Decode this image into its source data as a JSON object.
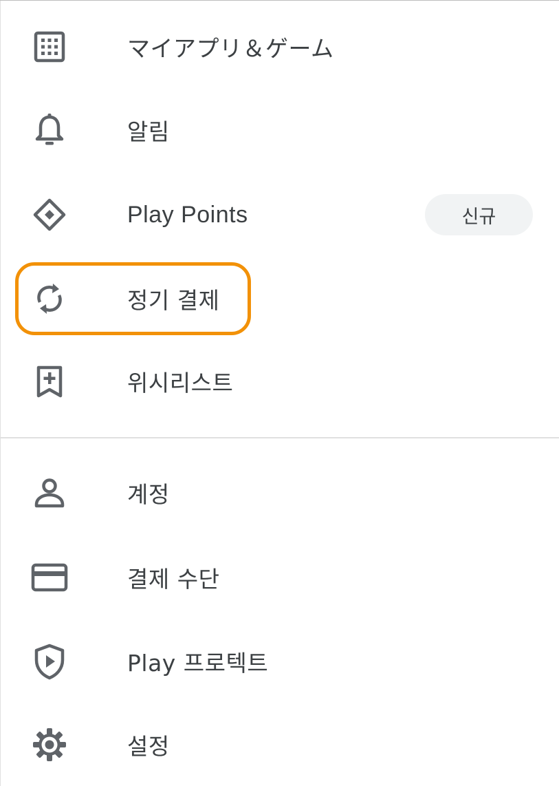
{
  "menu_top": [
    {
      "name": "my-apps-games",
      "icon": "apps-grid-icon",
      "label": "マイアプリ＆ゲーム"
    },
    {
      "name": "notifications",
      "icon": "bell-icon",
      "label": "알림"
    },
    {
      "name": "play-points",
      "icon": "diamond-icon",
      "label": "Play Points",
      "badge": "신규"
    },
    {
      "name": "subscriptions",
      "icon": "sync-icon",
      "label": "정기 결제"
    },
    {
      "name": "wishlist",
      "icon": "bookmark-add-icon",
      "label": "위시리스트"
    }
  ],
  "menu_bottom": [
    {
      "name": "account",
      "icon": "person-icon",
      "label": "계정"
    },
    {
      "name": "payment-methods",
      "icon": "credit-card-icon",
      "label": "결제 수단"
    },
    {
      "name": "play-protect",
      "icon": "shield-play-icon",
      "label": "Play 프로텍트"
    },
    {
      "name": "settings",
      "icon": "gear-icon",
      "label": "설정"
    }
  ],
  "highlight_color": "#f29108",
  "icon_color": "#5f6368",
  "text_color": "#3c4043"
}
